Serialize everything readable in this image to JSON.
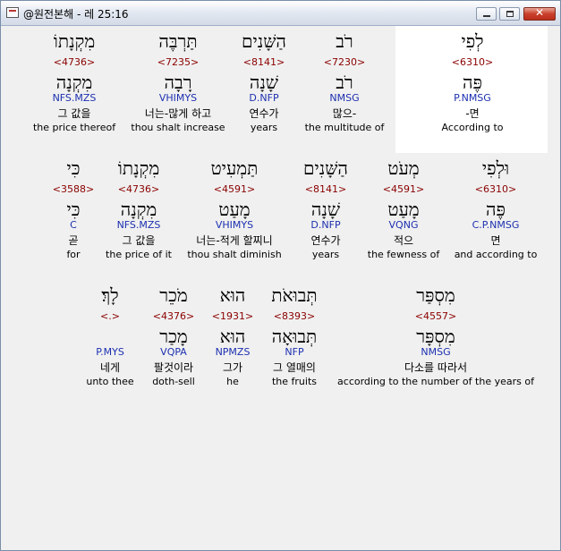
{
  "window": {
    "title": "@원전본해 - 레 25:16"
  },
  "rows": [
    [
      {
        "heb": "לְפִי",
        "num": "<6310>",
        "lex": "פֶּה",
        "morph": "P.NMSG",
        "kor": "-면",
        "eng": "According to"
      },
      {
        "heb": "רֹב",
        "num": "<7230>",
        "lex": "רֹב",
        "morph": "NMSG",
        "kor": "많으-",
        "eng": "the multitude of"
      },
      {
        "heb": "הַשָּׁנִים",
        "num": "<8141>",
        "lex": "שָׁנָה",
        "morph": "D.NFP",
        "kor": "연수가",
        "eng": "years"
      },
      {
        "heb": "תַּרְבֶּה",
        "num": "<7235>",
        "lex": "רָבָה",
        "morph": "VHIMYS",
        "kor": "너는-많게 하고",
        "eng": "thou shalt increase"
      },
      {
        "heb": "מִקְנָתוֹ",
        "num": "<4736>",
        "lex": "מִקְנָה",
        "morph": "NFS.MZS",
        "kor": "그 값을",
        "eng": "the price thereof"
      }
    ],
    [
      {
        "heb": "וּלְפִי",
        "num": "<6310>",
        "lex": "פֶּה",
        "morph": "C.P.NMSG",
        "kor": "면",
        "eng": "and according to"
      },
      {
        "heb": "מְעֹט",
        "num": "<4591>",
        "lex": "מָעַט",
        "morph": "VQNG",
        "kor": "적으",
        "eng": "the fewness of"
      },
      {
        "heb": "הַשָּׁנִים",
        "num": "<8141>",
        "lex": "שָׁנָה",
        "morph": "D.NFP",
        "kor": "연수가",
        "eng": "years"
      },
      {
        "heb": "תַּמְעִיט",
        "num": "<4591>",
        "lex": "מָעַט",
        "morph": "VHIMYS",
        "kor": "너는-적게 할찌니",
        "eng": "thou shalt diminish"
      },
      {
        "heb": "מִקְנָתוֹ",
        "num": "<4736>",
        "lex": "מִקְנָה",
        "morph": "NFS.MZS",
        "kor": "그 값을",
        "eng": "the price of it"
      },
      {
        "heb": "כִּי",
        "num": "<3588>",
        "lex": "כִּי",
        "morph": "C",
        "kor": "곧",
        "eng": "for"
      }
    ],
    [
      {
        "heb": "מִסְפַּר",
        "num": "<4557>",
        "lex": "מִסְפָּר",
        "morph": "NMSG",
        "kor": "다소를 따라서",
        "eng": "according to the number of the years of"
      },
      {
        "heb": "תְּבוּאֹת",
        "num": "<8393>",
        "lex": "תְּבוּאָה",
        "morph": "NFP",
        "kor": "그 열매의",
        "eng": "the fruits"
      },
      {
        "heb": "הוּא",
        "num": "<1931>",
        "lex": "הוּא",
        "morph": "NPMZS",
        "kor": "그가",
        "eng": "he"
      },
      {
        "heb": "מֹכֵר",
        "num": "<4376>",
        "lex": "מָכַר",
        "morph": "VQPA",
        "kor": "팔것이라",
        "eng": "doth-sell"
      },
      {
        "heb": "לָךְ׃",
        "num": "<.>",
        "lex": "",
        "morph": "P.MYS",
        "kor": "네게",
        "eng": "unto thee"
      }
    ]
  ]
}
